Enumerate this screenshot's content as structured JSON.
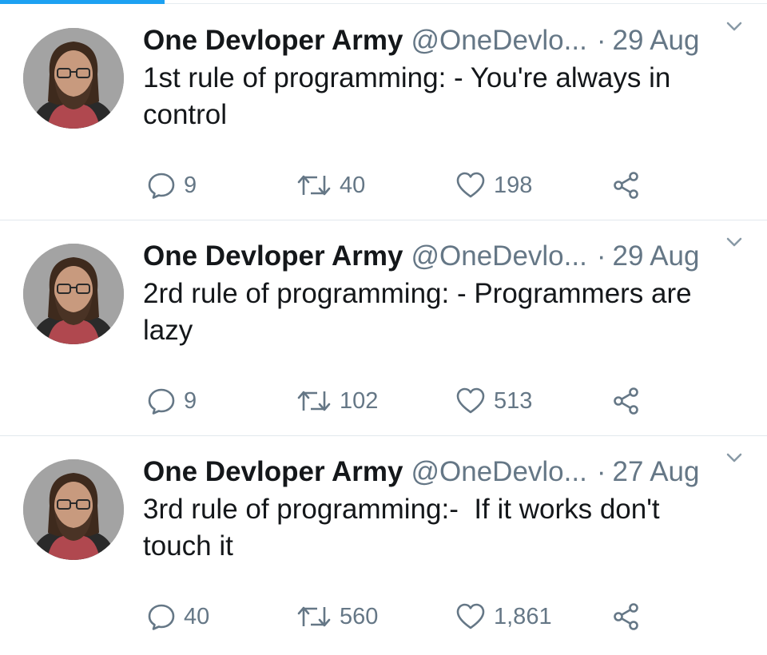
{
  "colors": {
    "accent": "#1da1f2",
    "text": "#14171a",
    "secondary": "#657786",
    "divider": "#e1e8ed"
  },
  "icons": {
    "reply": "reply-icon",
    "retweet": "retweet-icon",
    "like": "heart-icon",
    "share": "share-icon",
    "menu": "chevron-down-icon"
  },
  "tweets": [
    {
      "name": "One Devloper Army",
      "handle": "@OneDevlo...",
      "separator": "·",
      "date": "29 Aug",
      "text": "1st rule of programming: - You're always in control",
      "replies": "9",
      "retweets": "40",
      "likes": "198"
    },
    {
      "name": "One Devloper Army",
      "handle": "@OneDevlo...",
      "separator": "·",
      "date": "29 Aug",
      "text": "2rd rule of programming: - Programmers are lazy",
      "replies": "9",
      "retweets": "102",
      "likes": "513"
    },
    {
      "name": "One Devloper Army",
      "handle": "@OneDevlo...",
      "separator": "·",
      "date": "27 Aug",
      "text": "3rd rule of programming:-  If it works don't touch it",
      "replies": "40",
      "retweets": "560",
      "likes": "1,861"
    }
  ]
}
